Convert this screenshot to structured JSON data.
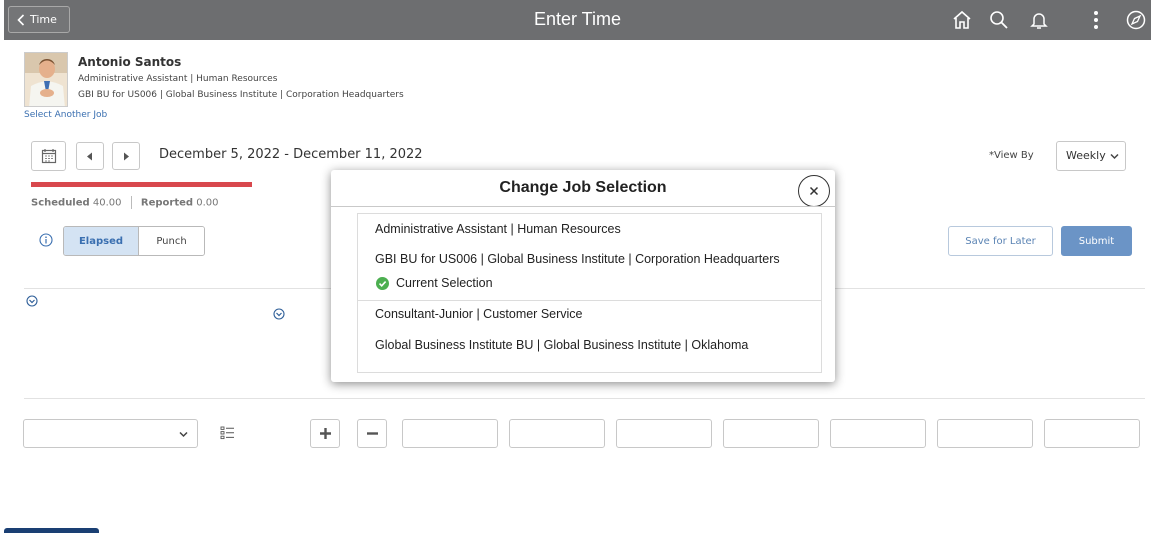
{
  "header": {
    "back_label": "Time",
    "title": "Enter Time",
    "icons": [
      "home-icon",
      "search-icon",
      "bell-icon",
      "more-vertical-icon",
      "compass-icon"
    ]
  },
  "employee": {
    "name": "Antonio Santos",
    "line1": "Administrative Assistant | Human Resources",
    "line2": "GBI BU for US006 | Global Business Institute | Corporation Headquarters",
    "select_job_link": "Select Another Job"
  },
  "period": {
    "date_range": "December 5, 2022 - December 11, 2022",
    "view_by_label": "*View By",
    "view_by_value": "Weekly"
  },
  "summary": {
    "scheduled_label": "Scheduled",
    "scheduled_value": "40.00",
    "reported_label": "Reported",
    "reported_value": "0.00"
  },
  "mode": {
    "elapsed_label": "Elapsed",
    "punch_label": "Punch"
  },
  "actions": {
    "save_label": "Save for Later",
    "submit_label": "Submit"
  },
  "modal": {
    "title": "Change Job Selection",
    "jobs": [
      {
        "line1": "Administrative Assistant | Human Resources",
        "line2": "GBI BU for US006 | Global Business Institute | Corporation Headquarters",
        "current_label": "Current Selection"
      },
      {
        "line1": "Consultant-Junior | Customer Service",
        "line2": "Global Business Institute BU | Global Business Institute | Oklahoma"
      }
    ]
  },
  "colors": {
    "header_bg": "#6d6e70",
    "accent_blue": "#6b94c6",
    "link_blue": "#3a6fb0",
    "progress_red": "#d8484d",
    "success_green": "#4caf50"
  }
}
